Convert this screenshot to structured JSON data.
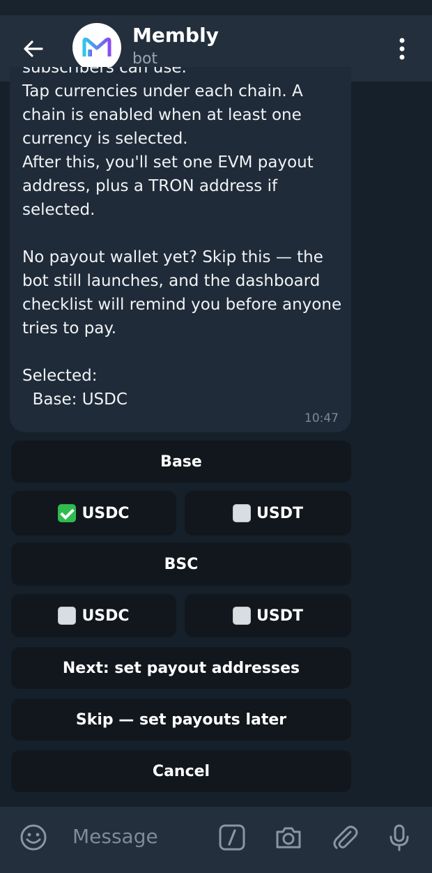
{
  "header": {
    "title": "Membly",
    "subtitle": "bot"
  },
  "message": {
    "text": "subscribers can use.\nTap currencies under each chain. A chain is enabled when at least one currency is selected.\nAfter this, you'll set one EVM payout address, plus a TRON address if selected.\n\nNo payout wallet yet? Skip this — the bot still launches, and the dashboard checklist will remind you before anyone tries to pay.\n\nSelected:\n  Base: USDC",
    "time": "10:47"
  },
  "keyboard": {
    "base": "Base",
    "base_usdc": "USDC",
    "base_usdt": "USDT",
    "bsc": "BSC",
    "bsc_usdc": "USDC",
    "bsc_usdt": "USDT",
    "next": "Next: set payout addresses",
    "skip": "Skip — set payouts later",
    "cancel": "Cancel"
  },
  "input": {
    "placeholder": "Message"
  },
  "colors": {
    "background": "#16202a",
    "header": "#232f3c",
    "bubble": "#1f2b38",
    "button": "#11171d",
    "check_on": "#2fbb4f"
  }
}
